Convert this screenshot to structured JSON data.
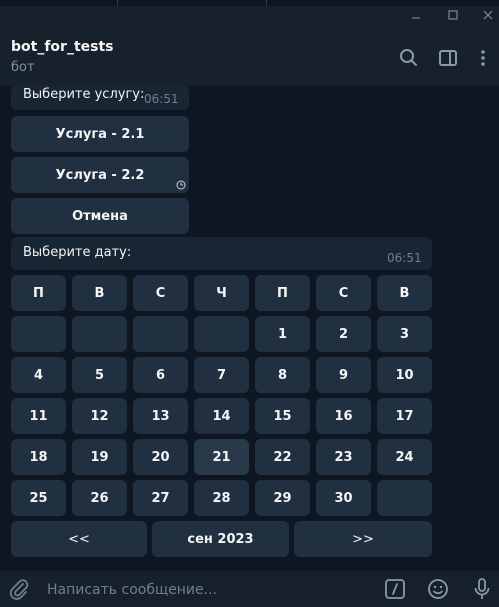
{
  "header": {
    "title": "bot_for_tests",
    "subtitle": "бот"
  },
  "messages": {
    "service_prompt": {
      "text": "Выберите услугу:",
      "time": "06:51"
    },
    "service_buttons": [
      "Услуга - 2.1",
      "Услуга - 2.2",
      "Отмена"
    ],
    "date_prompt": {
      "text": "Выберите дату:",
      "time": "06:51"
    }
  },
  "calendar": {
    "weekdays": [
      "П",
      "В",
      "С",
      "Ч",
      "П",
      "С",
      "В"
    ],
    "rows": [
      [
        "",
        "",
        "",
        "",
        "1",
        "2",
        "3"
      ],
      [
        "4",
        "5",
        "6",
        "7",
        "8",
        "9",
        "10"
      ],
      [
        "11",
        "12",
        "13",
        "14",
        "15",
        "16",
        "17"
      ],
      [
        "18",
        "19",
        "20",
        "21",
        "22",
        "23",
        "24"
      ],
      [
        "25",
        "26",
        "27",
        "28",
        "29",
        "30",
        ""
      ]
    ],
    "nav": {
      "prev": "<<",
      "month": "сен 2023",
      "next": ">>"
    }
  },
  "input": {
    "placeholder": "Написать сообщение..."
  },
  "colors": {
    "background": "#0e1621",
    "panel": "#17212b",
    "button": "#213041",
    "bubble": "#182533"
  }
}
